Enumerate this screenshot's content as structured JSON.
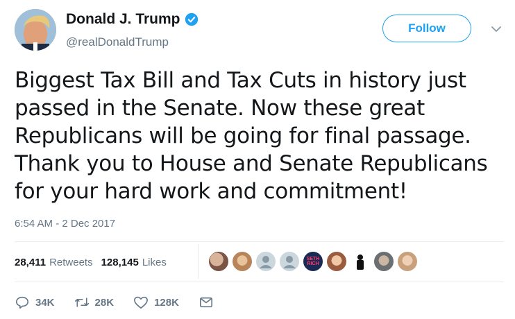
{
  "author": {
    "display_name": "Donald J. Trump",
    "handle": "@realDonaldTrump",
    "verified": true,
    "avatar_icon": "profile-photo"
  },
  "follow_label": "Follow",
  "tweet": {
    "lines": [
      "Biggest Tax Bill and Tax Cuts in history just",
      "passed in the Senate. Now these great",
      "Republicans will be going for final passage.",
      "Thank you to House and Senate Republicans",
      "for your hard work and commitment!"
    ],
    "timestamp": "6:54 AM - 2 Dec 2017"
  },
  "stats": {
    "retweets_count": "28,411",
    "retweets_label": "Retweets",
    "likes_count": "128,145",
    "likes_label": "Likes",
    "liker_avatar_count": 9,
    "liker_avatar_badge_text": "SETH RICH"
  },
  "actions": {
    "reply_count": "34K",
    "retweet_count": "28K",
    "like_count": "128K"
  },
  "colors": {
    "brand_blue": "#1da1f2",
    "secondary_text": "#657786",
    "primary_text": "#14171a",
    "divider": "#e6ecf0"
  }
}
